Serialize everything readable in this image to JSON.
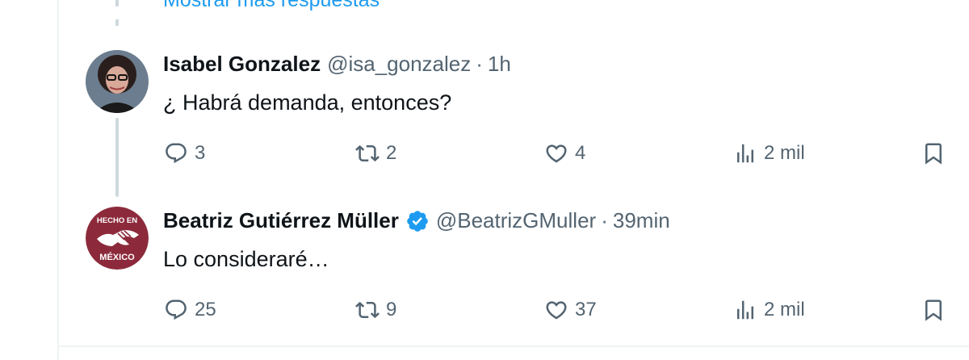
{
  "thread": {
    "show_more_label": "Mostrar más respuestas"
  },
  "tweets": [
    {
      "name": "Isabel Gonzalez",
      "handle": "@isa_gonzalez",
      "separator": "·",
      "time": "1h",
      "verified": false,
      "text": "¿ Habrá demanda, entonces?",
      "replies": "3",
      "retweets": "2",
      "likes": "4",
      "views": "2 mil"
    },
    {
      "name": "Beatriz Gutiérrez Müller",
      "handle": "@BeatrizGMuller",
      "separator": "·",
      "time": "39min",
      "verified": true,
      "avatar_text_top": "HECHO EN",
      "avatar_text_bottom": "MÉXICO",
      "text": "Lo consideraré…",
      "replies": "25",
      "retweets": "9",
      "likes": "37",
      "views": "2 mil"
    }
  ],
  "colors": {
    "accent": "#1d9bf0",
    "secondary_text": "#536471",
    "avatar_brand": "#8c2a3b"
  }
}
